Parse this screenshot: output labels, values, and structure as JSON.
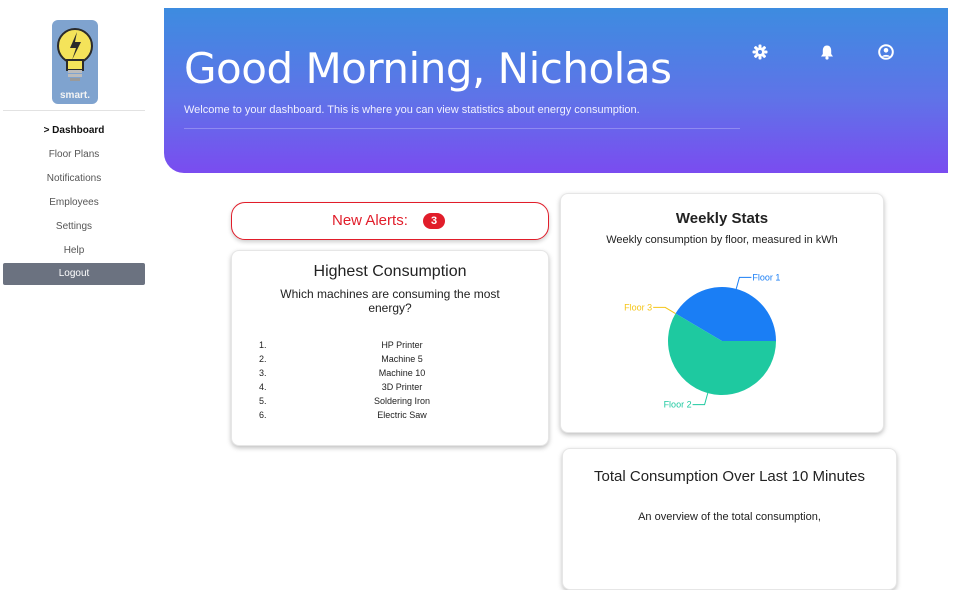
{
  "sidebar": {
    "logo_text": "smart.",
    "items": [
      {
        "label": "> Dashboard",
        "active": true
      },
      {
        "label": "Floor Plans"
      },
      {
        "label": "Notifications"
      },
      {
        "label": "Employees"
      },
      {
        "label": "Settings"
      },
      {
        "label": "Help"
      }
    ],
    "logout_label": "Logout"
  },
  "header": {
    "greeting": "Good Morning, Nicholas",
    "welcome": "Welcome to your dashboard. This is where you can view statistics about energy consumption.",
    "icons": [
      "gear-icon",
      "bell-icon",
      "user-circle-icon"
    ]
  },
  "alerts": {
    "label": "New Alerts:",
    "count": "3",
    "color": "#e11d2a"
  },
  "highest_consumption": {
    "title": "Highest Consumption",
    "subtitle": "Which machines are consuming the most energy?",
    "items": [
      {
        "num": "1.",
        "name": "HP Printer"
      },
      {
        "num": "2.",
        "name": "Machine 5"
      },
      {
        "num": "3.",
        "name": "Machine 10"
      },
      {
        "num": "4.",
        "name": "3D Printer"
      },
      {
        "num": "5.",
        "name": "Soldering Iron"
      },
      {
        "num": "6.",
        "name": "Electric Saw"
      }
    ]
  },
  "weekly_stats": {
    "title": "Weekly Stats",
    "subtitle": "Weekly consumption by floor, measured in kWh"
  },
  "total_consumption": {
    "title": "Total Consumption Over Last 10 Minutes",
    "subtitle": "An overview of the total consumption,"
  },
  "chart_data": {
    "type": "pie",
    "categories": [
      "Floor 1",
      "Floor 3",
      "Floor 2"
    ],
    "values": [
      41.5,
      0.0,
      58.5
    ],
    "colors": [
      "#1a7ef5",
      "#f5c518",
      "#1ec9a0"
    ],
    "title": "",
    "label_placement": "outside with leader lines"
  }
}
